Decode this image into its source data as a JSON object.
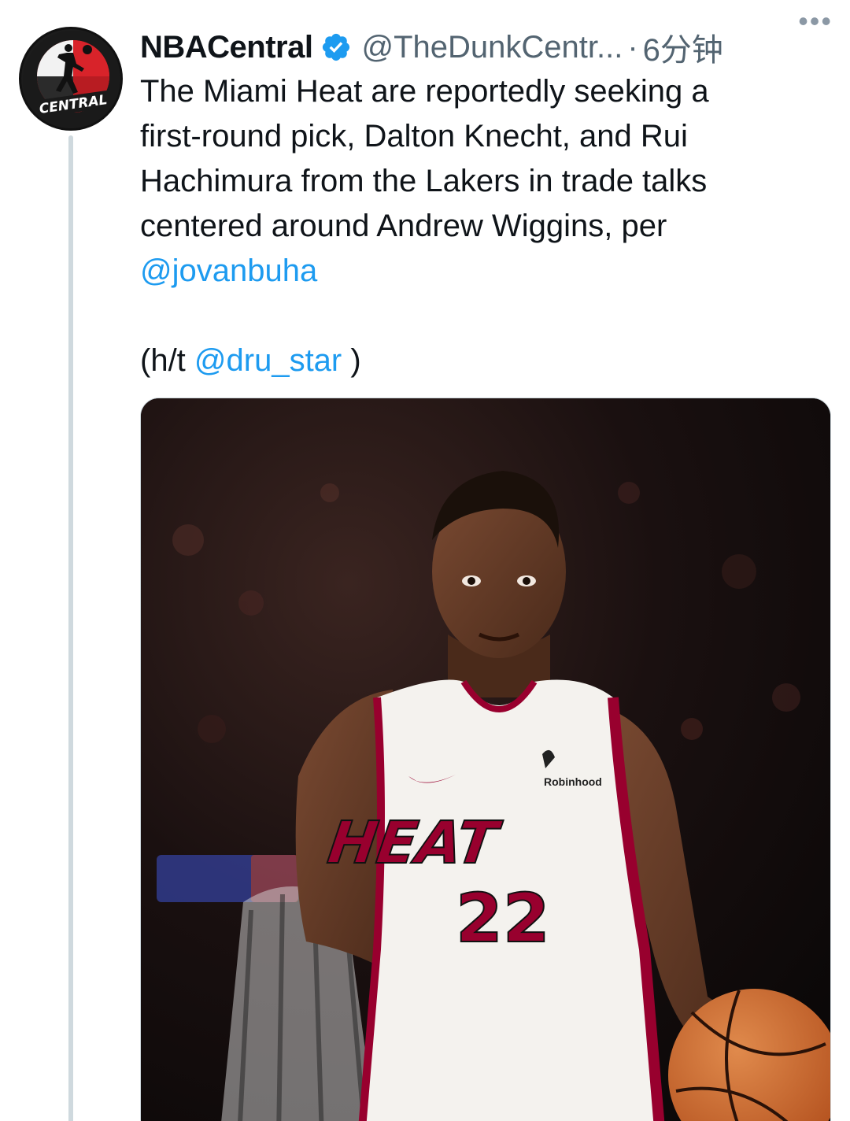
{
  "author": {
    "display_name": "NBACentral",
    "handle": "@TheDunkCentr...",
    "separator": "·",
    "time": "6分钟",
    "avatar_text": "CENTRAL"
  },
  "tweet": {
    "text_lines": [
      "The Miami Heat are reportedly seeking a",
      "first-round pick, Dalton Knecht, and Rui",
      "Hachimura from the Lakers in trade talks",
      "centered around Andrew Wiggins, per"
    ],
    "mention_1": "@jovanbuha",
    "ht_prefix": "(h/t ",
    "mention_2": "@dru_star",
    "ht_suffix": " )"
  },
  "media": {
    "jersey_sponsor": "Robinhood",
    "jersey_team": "HEAT",
    "jersey_number": "22"
  },
  "colors": {
    "link": "#1d9bf0",
    "verified": "#1d9bf0",
    "heat_red": "#98002e"
  },
  "icons": [
    "verified-badge-icon",
    "more-options-icon"
  ]
}
